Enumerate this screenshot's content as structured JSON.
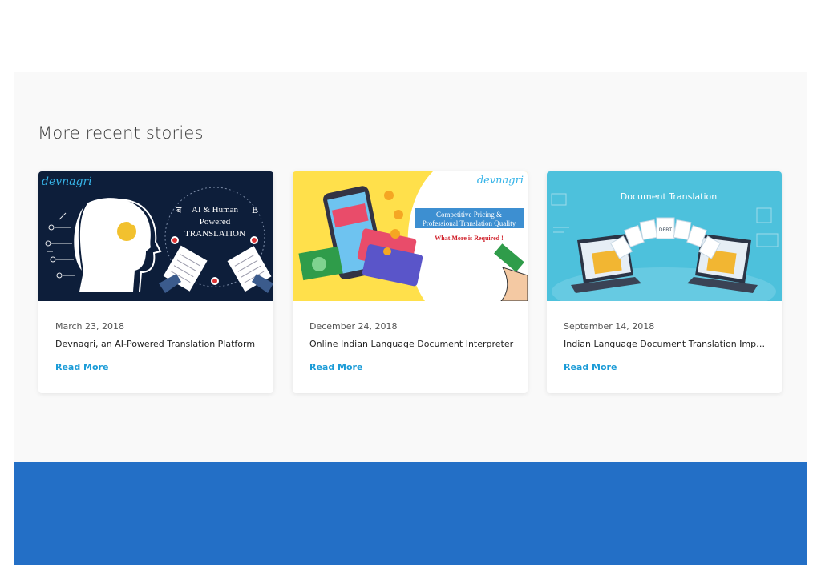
{
  "section": {
    "title": "More recent stories"
  },
  "stories": [
    {
      "date": "March 23, 2018",
      "title": "Devnagri, an AI-Powered Translation Platform",
      "link_label": "Read More",
      "image": {
        "brand": "devnagri",
        "caption_lines": [
          "AI & Human",
          "Powered",
          "TRANSLATION"
        ],
        "glyph_left": "ब",
        "glyph_right": "B"
      }
    },
    {
      "date": "December 24, 2018",
      "title": "Online Indian Language Document Interpreter",
      "link_label": "Read More",
      "image": {
        "brand": "devnagri",
        "caption_lines": [
          "Competitive Pricing &",
          "Professional Translation Quality"
        ],
        "tagline": "What More is Required !"
      }
    },
    {
      "date": "September 14, 2018",
      "title": "Indian Language Document Translation Importance",
      "link_label": "Read More",
      "image": {
        "caption": "Document Translation",
        "doc_label": "DEBT"
      }
    }
  ],
  "colors": {
    "link": "#1a9bd7",
    "footer": "#236fc6",
    "section_bg": "#f9f9f9"
  }
}
